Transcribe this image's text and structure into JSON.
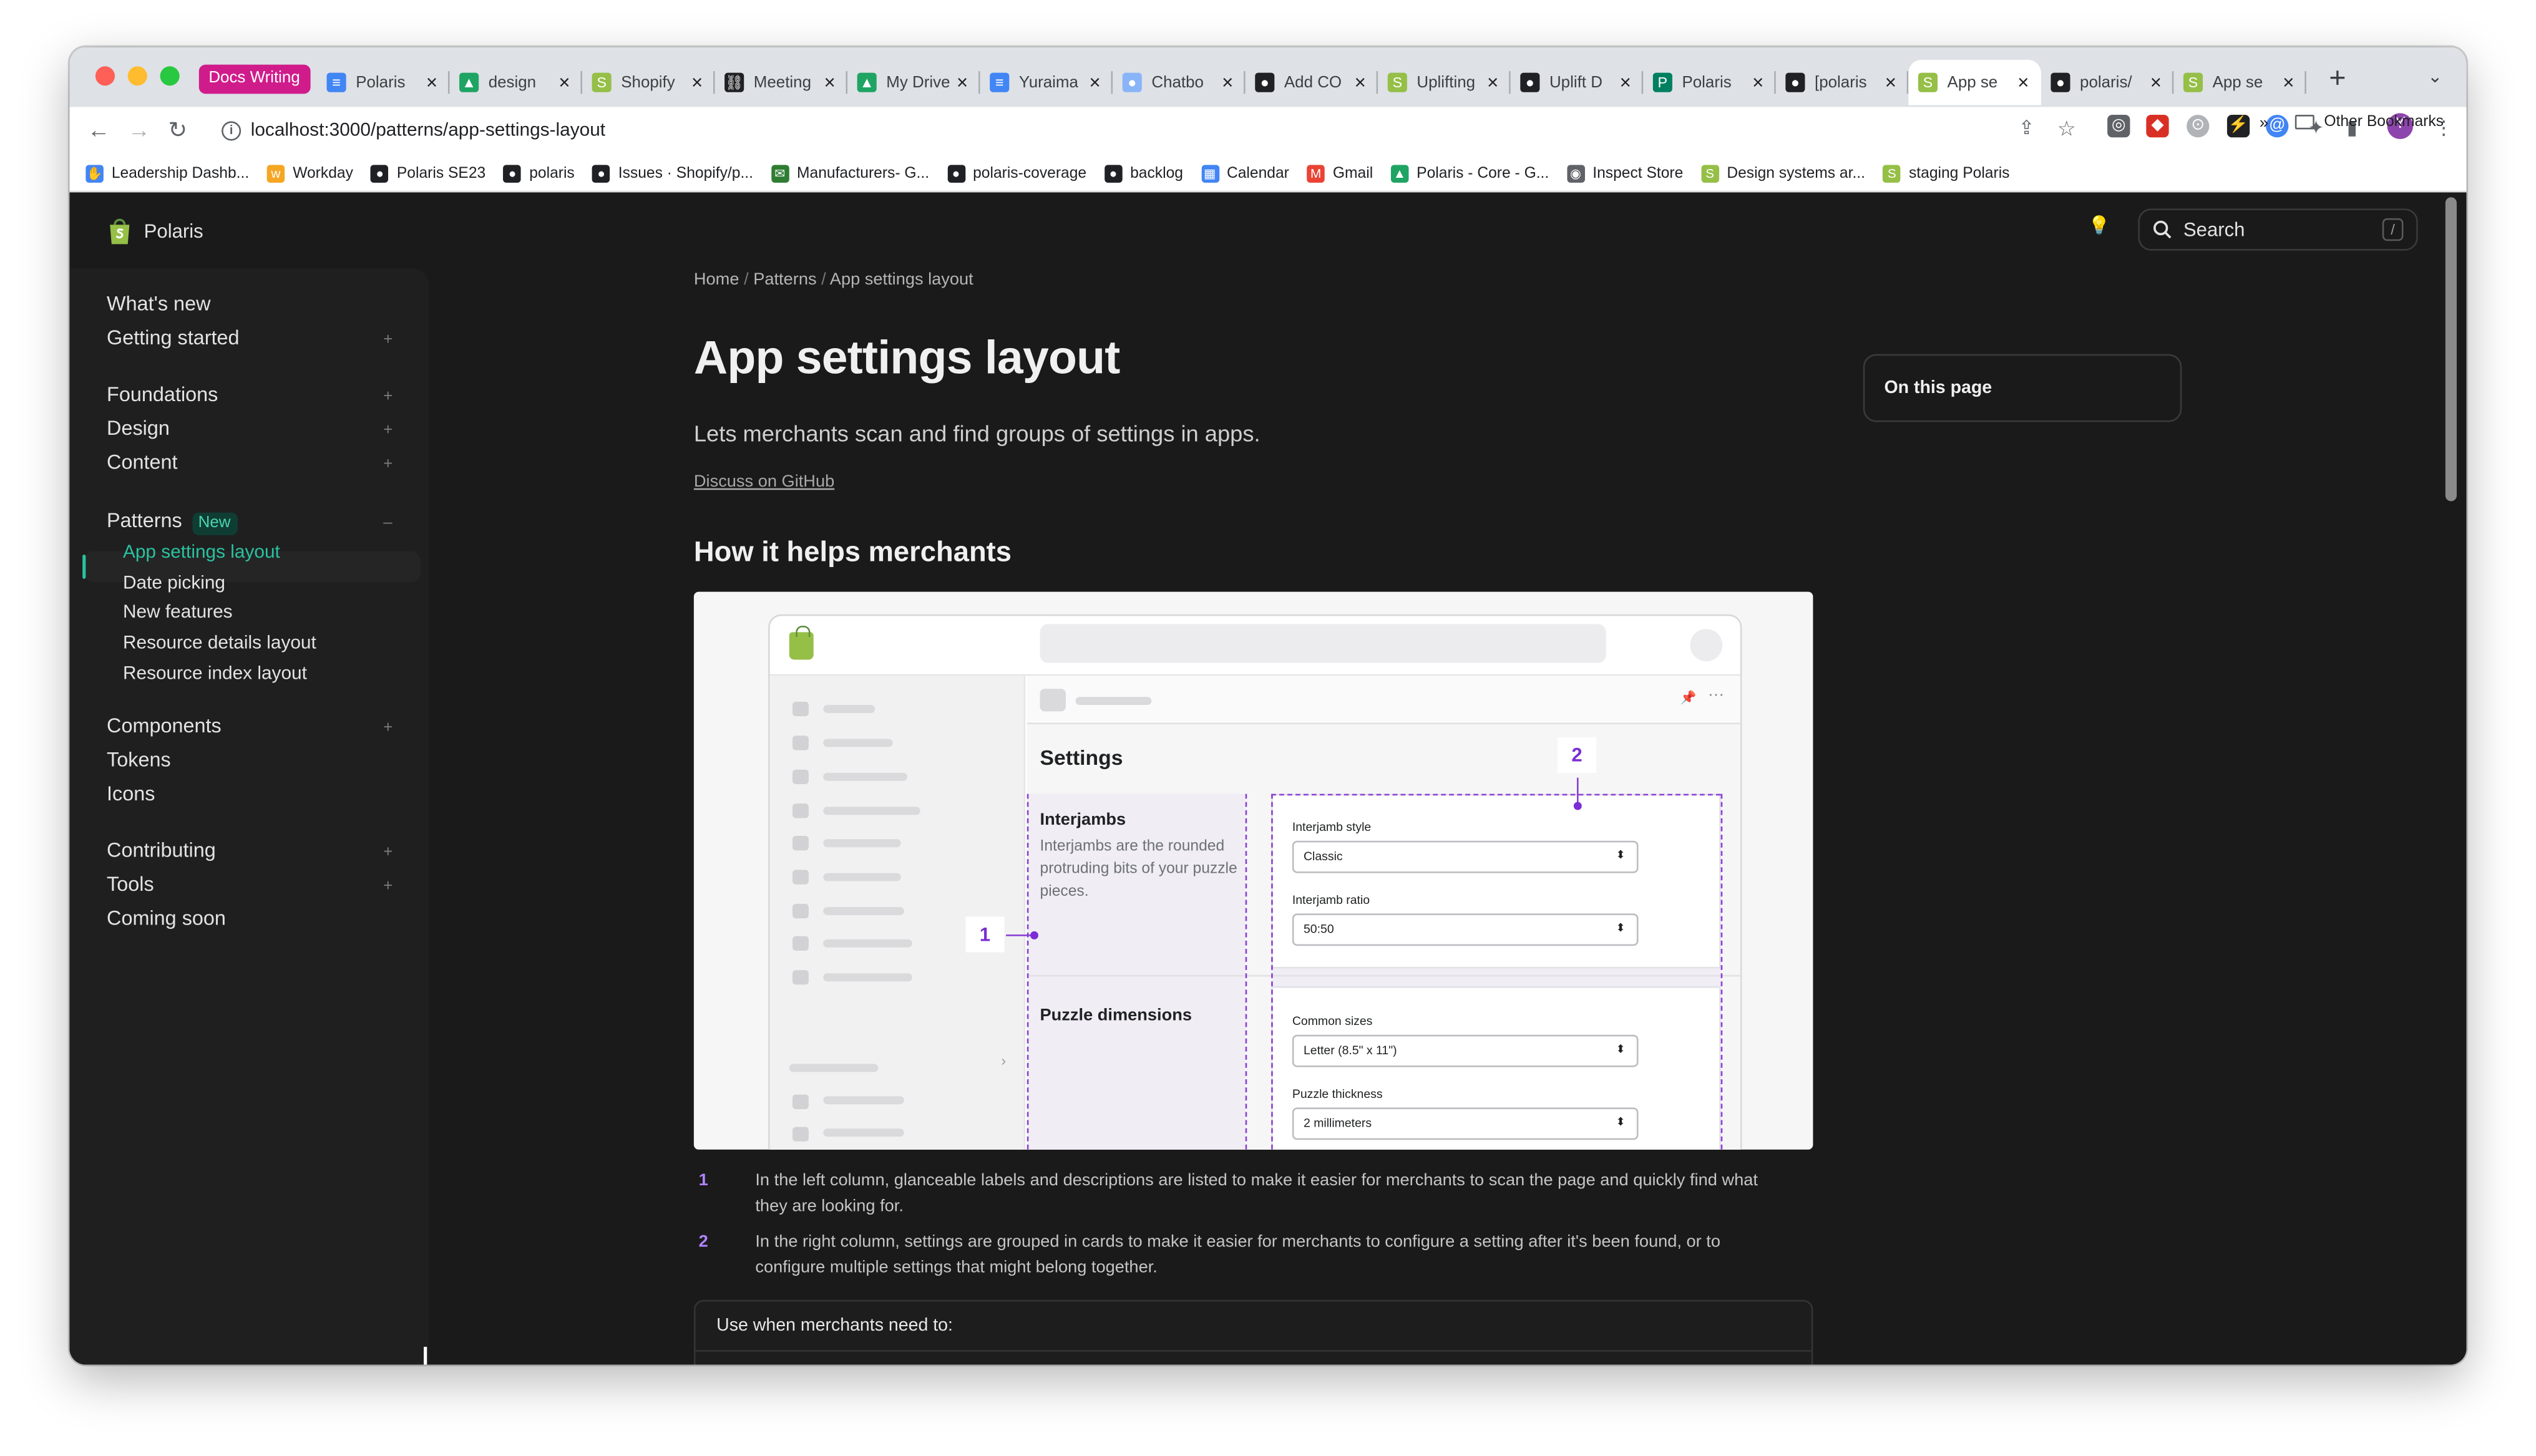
{
  "browser": {
    "tab_group_label": "Docs Writing",
    "tabs": [
      {
        "title": "Polaris",
        "icon": "google-docs-icon",
        "color": "#4285f4"
      },
      {
        "title": "design",
        "icon": "google-drive-icon",
        "color": "#1fa463"
      },
      {
        "title": "Shopify",
        "icon": "shopify-icon",
        "color": "#95bf47"
      },
      {
        "title": "Meeting",
        "icon": "link-icon",
        "color": "#202124"
      },
      {
        "title": "My Drive",
        "icon": "google-drive-icon",
        "color": "#1fa463"
      },
      {
        "title": "Yuraima",
        "icon": "google-docs-icon",
        "color": "#4285f4"
      },
      {
        "title": "Chatbo",
        "icon": "chat-icon",
        "color": "#8ab4f8"
      },
      {
        "title": "Add CO",
        "icon": "github-icon",
        "color": "#202124"
      },
      {
        "title": "Uplifting",
        "icon": "shopify-icon",
        "color": "#95bf47"
      },
      {
        "title": "Uplift D",
        "icon": "github-icon",
        "color": "#202124"
      },
      {
        "title": "Polaris",
        "icon": "polaris-icon",
        "color": "#008060"
      },
      {
        "title": "[polaris",
        "icon": "github-icon",
        "color": "#202124"
      },
      {
        "title": "App se",
        "icon": "shopify-icon",
        "color": "#95bf47",
        "active": true
      },
      {
        "title": "polaris/",
        "icon": "github-icon",
        "color": "#202124"
      },
      {
        "title": "App se",
        "icon": "shopify-icon",
        "color": "#95bf47"
      }
    ],
    "url": "localhost:3000/patterns/app-settings-layout",
    "profile_initial": "Y",
    "bookmarks": [
      {
        "label": "Leadership Dashb...",
        "icon": "hand-icon",
        "color": "#4285f4"
      },
      {
        "label": "Workday",
        "icon": "workday-icon",
        "color": "#f5a623"
      },
      {
        "label": "Polaris SE23",
        "icon": "github-icon",
        "color": "#202124"
      },
      {
        "label": "polaris",
        "icon": "github-icon",
        "color": "#202124"
      },
      {
        "label": "Issues · Shopify/p...",
        "icon": "github-icon",
        "color": "#202124"
      },
      {
        "label": "Manufacturers- G...",
        "icon": "mail-icon",
        "color": "#2e7d32"
      },
      {
        "label": "polaris-coverage",
        "icon": "github-icon",
        "color": "#202124"
      },
      {
        "label": "backlog",
        "icon": "github-icon",
        "color": "#202124"
      },
      {
        "label": "Calendar",
        "icon": "calendar-icon",
        "color": "#4285f4"
      },
      {
        "label": "Gmail",
        "icon": "gmail-icon",
        "color": "#ea4335"
      },
      {
        "label": "Polaris - Core - G...",
        "icon": "google-drive-icon",
        "color": "#1fa463"
      },
      {
        "label": "Inspect Store",
        "icon": "globe-icon",
        "color": "#5f6368"
      },
      {
        "label": "Design systems ar...",
        "icon": "shopify-icon",
        "color": "#95bf47"
      },
      {
        "label": "staging Polaris",
        "icon": "shopify-icon",
        "color": "#95bf47"
      }
    ],
    "bookmarks_overflow": "»",
    "other_bookmarks": "Other Bookmarks"
  },
  "site": {
    "logo_text": "Polaris",
    "search_placeholder": "Search",
    "search_shortcut": "/"
  },
  "sidebar": {
    "groups": [
      [
        {
          "label": "What's new",
          "expandable": false
        },
        {
          "label": "Getting started",
          "expandable": true
        }
      ],
      [
        {
          "label": "Foundations",
          "expandable": true
        },
        {
          "label": "Design",
          "expandable": true
        },
        {
          "label": "Content",
          "expandable": true
        }
      ],
      [
        {
          "label": "Patterns",
          "badge": "New",
          "expanded": true
        }
      ],
      [
        {
          "label": "Components",
          "expandable": true
        },
        {
          "label": "Tokens",
          "expandable": false
        },
        {
          "label": "Icons",
          "expandable": false
        }
      ],
      [
        {
          "label": "Contributing",
          "expandable": true
        },
        {
          "label": "Tools",
          "expandable": true
        },
        {
          "label": "Coming soon",
          "expandable": false
        }
      ]
    ],
    "pattern_items": [
      "App settings layout",
      "Date picking",
      "New features",
      "Resource details layout",
      "Resource index layout"
    ],
    "active_item": "App settings layout",
    "accent": "#2ac2a0"
  },
  "page": {
    "breadcrumb": [
      "Home",
      "Patterns",
      "App settings layout"
    ],
    "title": "App settings layout",
    "lead": "Lets merchants scan and find groups of settings in apps.",
    "discuss_link": "Discuss on GitHub",
    "section_heading": "How it helps merchants",
    "on_this_page": "On this page",
    "annotations": [
      {
        "num": "1",
        "text": "In the left column, glanceable labels and descriptions are listed to make it easier for merchants to scan the page and quickly find what they are looking for."
      },
      {
        "num": "2",
        "text": "In the right column, settings are grouped in cards to make it easier for merchants to configure a setting after it's been found, or to configure multiple settings that might belong together."
      }
    ],
    "use_when": "Use when merchants need to:"
  },
  "figure": {
    "settings_title": "Settings",
    "groups": [
      {
        "label": "Interjambs",
        "description": "Interjambs are the rounded protruding bits of your puzzle pieces.",
        "fields": [
          {
            "label": "Interjamb style",
            "value": "Classic"
          },
          {
            "label": "Interjamb ratio",
            "value": "50:50"
          }
        ]
      },
      {
        "label": "Puzzle dimensions",
        "description": "",
        "fields": [
          {
            "label": "Common sizes",
            "value": "Letter (8.5\" x 11\")"
          },
          {
            "label": "Puzzle thickness",
            "value": "2 millimeters"
          }
        ]
      }
    ],
    "markers": [
      "1",
      "2"
    ],
    "marker_color": "#7b2ed4"
  }
}
